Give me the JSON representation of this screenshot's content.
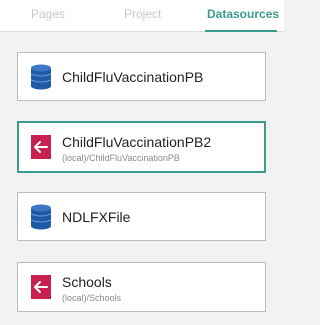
{
  "tabs": {
    "pages": "Pages",
    "project": "Project",
    "datasources": "Datasources",
    "active": "datasources"
  },
  "colors": {
    "accent": "#3a9c8e",
    "database_icon": "#1f5aa6",
    "link_icon": "#c8214f"
  },
  "datasources": [
    {
      "name": "ChildFluVaccinationPB",
      "subtitle": "",
      "icon": "database-icon",
      "selected": false
    },
    {
      "name": "ChildFluVaccinationPB2",
      "subtitle": "(local)/ChildFluVaccinationPB",
      "icon": "linked-source-icon",
      "selected": true
    },
    {
      "name": "NDLFXFile",
      "subtitle": "",
      "icon": "database-icon",
      "selected": false
    },
    {
      "name": "Schools",
      "subtitle": "(local)/Schools",
      "icon": "linked-source-icon",
      "selected": false
    }
  ]
}
